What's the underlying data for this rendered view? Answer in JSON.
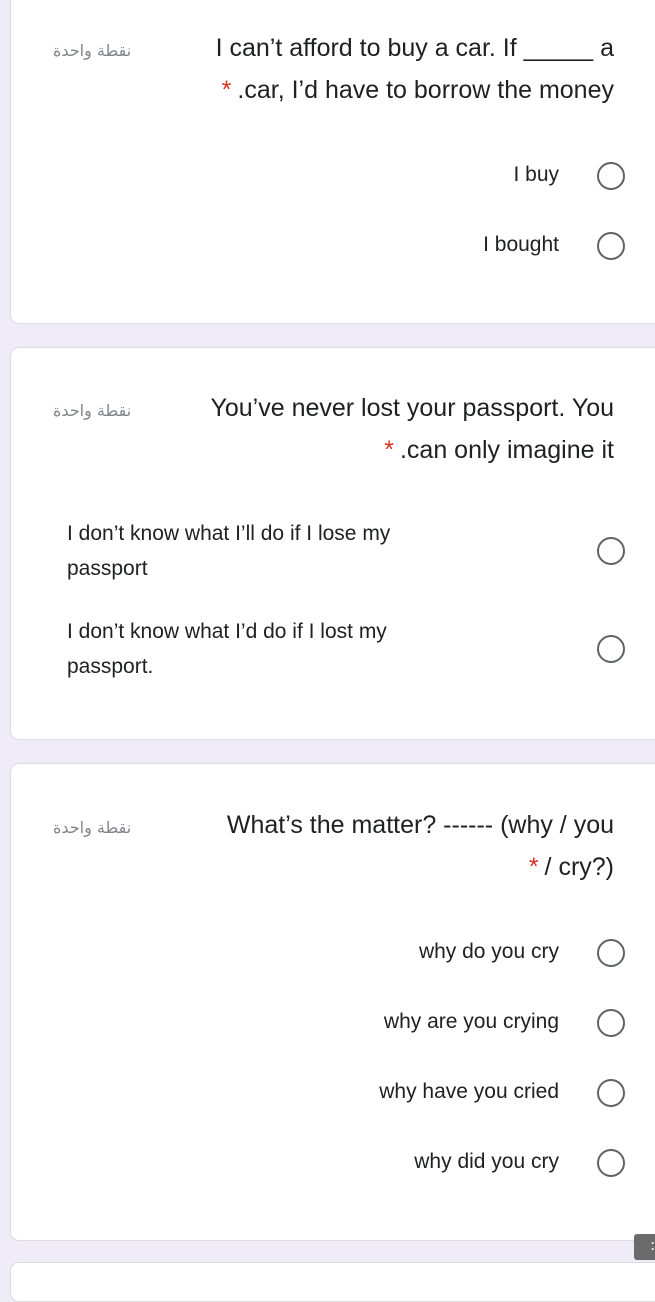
{
  "questions": [
    {
      "points": "نقطة واحدة",
      "line1": "I can’t afford to buy a car. If _____ a",
      "line2": ".car, I’d have to borrow the money",
      "required": "*",
      "options": [
        "I buy",
        "I bought"
      ]
    },
    {
      "points": "نقطة واحدة",
      "line1": "You’ve never lost your passport. You",
      "line2": ".can only imagine it",
      "required": "*",
      "options": [
        "I don’t know what I’ll do if I lose my passport",
        "I don’t know what I’d do if I lost my passport."
      ]
    },
    {
      "points": "نقطة واحدة",
      "line1": "What’s the matter? ------ (why / you",
      "line2": "/ cry?)",
      "required": "*",
      "options": [
        "why do you cry",
        "why are you crying",
        "why have you cried",
        "why did you cry"
      ]
    }
  ],
  "colors": {
    "background": "#efebf7",
    "card": "#ffffff",
    "required": "#d93025",
    "radio_border": "#5f6368"
  },
  "icons": {
    "radio": "radio-unchecked-icon",
    "fab": "more-vert-icon"
  }
}
